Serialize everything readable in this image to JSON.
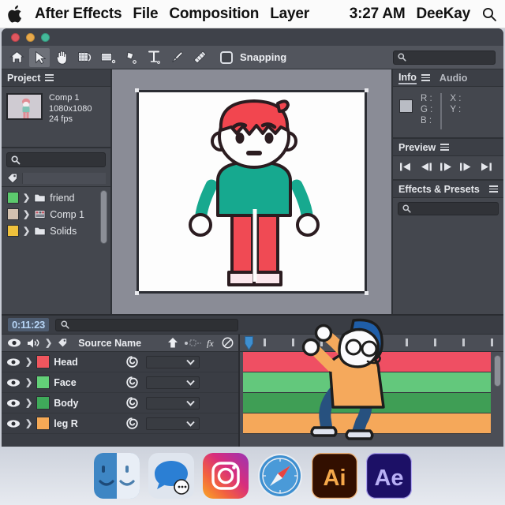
{
  "menubar": {
    "apple_icon": "apple-logo",
    "items": [
      "After Effects",
      "File",
      "Composition",
      "Layer"
    ],
    "time": "3:27 AM",
    "user": "DeeKay",
    "search_icon": "search-icon"
  },
  "window": {
    "traffic_lights": [
      "close",
      "minimize",
      "zoom"
    ]
  },
  "toolbar": {
    "tools": [
      {
        "name": "home-icon",
        "label": "Home"
      },
      {
        "name": "selection-arrow-icon",
        "label": "Selection Tool"
      },
      {
        "name": "hand-icon",
        "label": "Hand Tool"
      },
      {
        "name": "rotation-icon",
        "label": "Rotation Tool"
      },
      {
        "name": "region-of-interest-icon",
        "label": "Region of Interest"
      },
      {
        "name": "pen-icon",
        "label": "Pen Tool"
      },
      {
        "name": "text-icon",
        "label": "Type Tool"
      },
      {
        "name": "brush-icon",
        "label": "Brush Tool"
      },
      {
        "name": "clone-stamp-icon",
        "label": "Clone Stamp"
      }
    ],
    "snapping_label": "Snapping",
    "snapping_checked": false,
    "search_placeholder": ""
  },
  "project": {
    "tab_label": "Project",
    "menu_icon": "hamburger-icon",
    "comp_name": "Comp 1",
    "comp_resolution": "1080x1080",
    "comp_fps": "24 fps",
    "search_icon": "search-icon",
    "search_value": "",
    "tag_icon": "tag-icon",
    "items": [
      {
        "label": "friend",
        "swatch": "#5cc96d",
        "icon": "folder-icon"
      },
      {
        "label": "Comp 1",
        "swatch": "#d3c1b0",
        "icon": "composition-icon"
      },
      {
        "label": "Solids",
        "swatch": "#efc13c",
        "icon": "folder-icon"
      }
    ]
  },
  "info_panel": {
    "tab_label": "Info",
    "menu_icon": "hamburger-icon",
    "audio_tab_label": "Audio",
    "channels": [
      "R :",
      "G :",
      "B :"
    ],
    "coords": [
      "X :",
      "Y :"
    ]
  },
  "preview_panel": {
    "tab_label": "Preview",
    "menu_icon": "hamburger-icon",
    "controls": [
      "first-frame-icon",
      "prev-frame-icon",
      "play-icon",
      "next-frame-icon",
      "last-frame-icon"
    ]
  },
  "effects_panel": {
    "tab_label": "Effects & Presets",
    "menu_icon": "hamburger-icon",
    "search_icon": "search-icon",
    "search_value": ""
  },
  "timeline": {
    "timecode": "0:11:23",
    "search_icon": "search-icon",
    "search_value": "",
    "column_header": "Source Name",
    "header_icons": [
      "parent-icon",
      "transform-icon",
      "effects-fx-icon",
      "motion-blur-icon"
    ],
    "layers": [
      {
        "name": "Head",
        "swatch": "#f0565e",
        "bar_color": "#ef4f63",
        "eye_icon": "eye-icon",
        "parent_icon": "pick-whip-icon",
        "parent_value": ""
      },
      {
        "name": "Face",
        "swatch": "#63d078",
        "bar_color": "#63c87c",
        "eye_icon": "eye-icon",
        "parent_icon": "pick-whip-icon",
        "parent_value": ""
      },
      {
        "name": "Body",
        "swatch": "#3faa5a",
        "bar_color": "#3f9e55",
        "eye_icon": "eye-icon",
        "parent_icon": "pick-whip-icon",
        "parent_value": ""
      },
      {
        "name": "leg R",
        "swatch": "#f5a956",
        "bar_color": "#f5a85a",
        "eye_icon": "eye-icon",
        "parent_icon": "pick-whip-icon",
        "parent_value": ""
      }
    ],
    "playhead_icon": "playhead-icon",
    "tick_count": 9
  },
  "comp_viewer": {
    "character": "standing-boy-illustration",
    "canvas_background": "#fdfdfd"
  },
  "dancer": {
    "character": "dancing-person-illustration"
  },
  "dock": {
    "icons": [
      {
        "name": "finder-icon",
        "label": "Finder"
      },
      {
        "name": "messages-icon",
        "label": "Messages"
      },
      {
        "name": "instagram-icon",
        "label": "Instagram"
      },
      {
        "name": "safari-icon",
        "label": "Safari"
      },
      {
        "name": "illustrator-icon",
        "label": "Ai"
      },
      {
        "name": "after-effects-icon",
        "label": "Ae"
      }
    ]
  },
  "colors": {
    "panel_bg": "#44474e",
    "window_bg": "#3a3d44",
    "toolbar_bg": "#52555d",
    "comp_bg": "#8a8c96",
    "accent_blue": "#b6d4f5"
  }
}
